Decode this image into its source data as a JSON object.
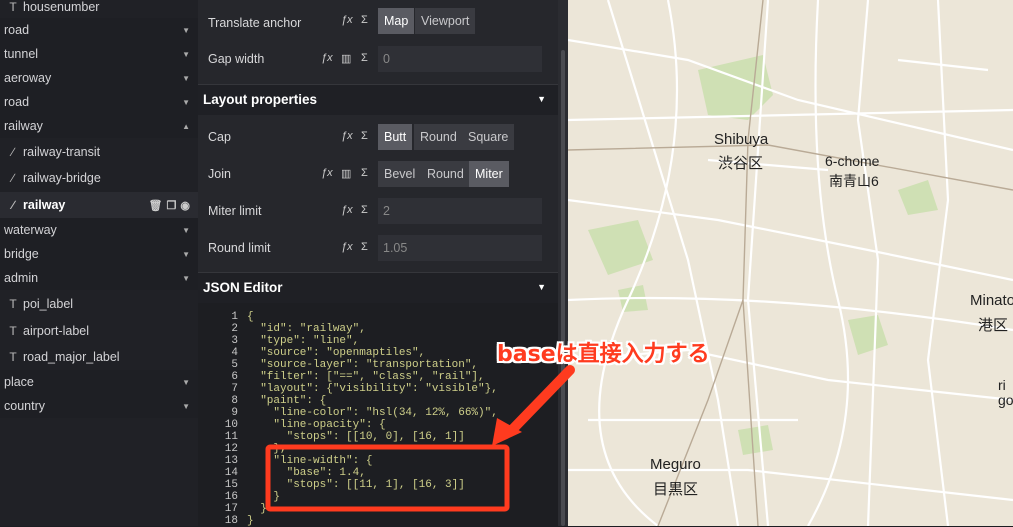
{
  "layers": {
    "items": [
      {
        "label": "housenumber",
        "type": "symbol",
        "kind": "sub"
      },
      {
        "label": "road",
        "kind": "group",
        "expanded": false
      },
      {
        "label": "tunnel",
        "kind": "group",
        "expanded": false
      },
      {
        "label": "aeroway",
        "kind": "group",
        "expanded": false
      },
      {
        "label": "road",
        "kind": "group",
        "expanded": false
      },
      {
        "label": "railway",
        "kind": "group",
        "expanded": true
      },
      {
        "label": "railway-transit",
        "type": "line",
        "kind": "sub"
      },
      {
        "label": "railway-bridge",
        "type": "line",
        "kind": "sub"
      },
      {
        "label": "railway",
        "type": "line",
        "kind": "sub",
        "active": true
      },
      {
        "label": "waterway",
        "kind": "group",
        "expanded": false
      },
      {
        "label": "bridge",
        "kind": "group",
        "expanded": false
      },
      {
        "label": "admin",
        "kind": "group",
        "expanded": false
      },
      {
        "label": "poi_label",
        "type": "symbol",
        "kind": "sub"
      },
      {
        "label": "airport-label",
        "type": "symbol",
        "kind": "sub"
      },
      {
        "label": "road_major_label",
        "type": "symbol",
        "kind": "sub"
      },
      {
        "label": "place",
        "kind": "group",
        "expanded": false
      },
      {
        "label": "country",
        "kind": "group",
        "expanded": false
      }
    ]
  },
  "props": {
    "translate_anchor": {
      "label": "Translate anchor",
      "options": [
        "Map",
        "Viewport"
      ],
      "selected": "Map"
    },
    "gap_width": {
      "label": "Gap width",
      "value": "0"
    },
    "layout_section": "Layout properties",
    "cap": {
      "label": "Cap",
      "options": [
        "Butt",
        "Round",
        "Square"
      ],
      "selected": "Butt"
    },
    "join": {
      "label": "Join",
      "options": [
        "Bevel",
        "Round",
        "Miter"
      ],
      "selected": "Miter"
    },
    "miter_limit": {
      "label": "Miter limit",
      "value": "2"
    },
    "round_limit": {
      "label": "Round limit",
      "value": "1.05"
    },
    "json_section": "JSON Editor"
  },
  "json_lines": [
    "{",
    "  \"id\": \"railway\",",
    "  \"type\": \"line\",",
    "  \"source\": \"openmaptiles\",",
    "  \"source-layer\": \"transportation\",",
    "  \"filter\": [\"==\", \"class\", \"rail\"],",
    "  \"layout\": {\"visibility\": \"visible\"},",
    "  \"paint\": {",
    "    \"line-color\": \"hsl(34, 12%, 66%)\",",
    "    \"line-opacity\": {",
    "      \"stops\": [[10, 0], [16, 1]]",
    "    },",
    "    \"line-width\": {",
    "      \"base\": 1.4,",
    "      \"stops\": [[11, 1], [16, 3]]",
    "    }",
    "  }",
    "}"
  ],
  "annotation": {
    "text": "baseは直接入力する",
    "color": "#ff3b1f"
  },
  "map": {
    "labels": [
      {
        "id": "shibuya-en",
        "text": "Shibuya"
      },
      {
        "id": "shibuya-ja",
        "text": "渋谷区"
      },
      {
        "id": "6chome-en",
        "text": "6-chome"
      },
      {
        "id": "6chome-ja",
        "text": "南青山6"
      },
      {
        "id": "minato-en",
        "text": "Minato"
      },
      {
        "id": "minato-ja",
        "text": "港区"
      },
      {
        "id": "meguro-en",
        "text": "Meguro"
      },
      {
        "id": "meguro-ja",
        "text": "目黒区"
      },
      {
        "id": "partial-1",
        "text": "ri"
      },
      {
        "id": "partial-2",
        "text": "go"
      }
    ]
  },
  "colors": {
    "accent": "#ff3b1f",
    "map_bg": "#ece6d8",
    "park": "#cfe0b4",
    "road": "#ffffff"
  }
}
